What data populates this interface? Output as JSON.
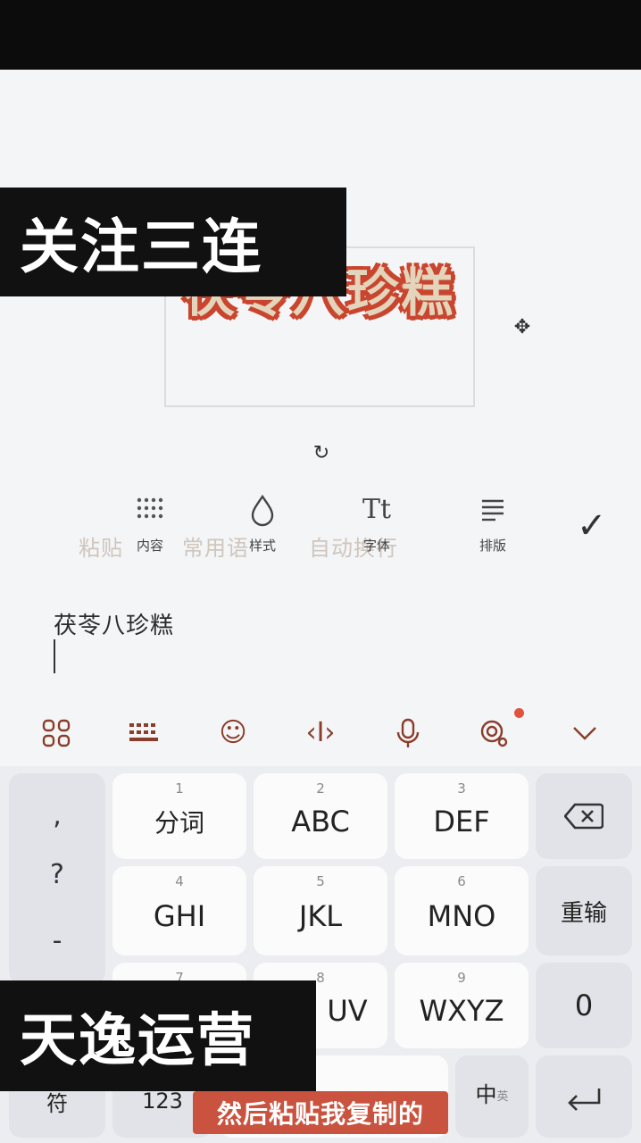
{
  "overlay": {
    "top_banner": "关注三连",
    "bottom_banner": "天逸运营",
    "caption": "然后粘贴我复制的"
  },
  "canvas": {
    "sticker_text": "茯苓八珍糕",
    "move_icon": "move-icon",
    "rotate_icon": "rotate-icon"
  },
  "toolbar": {
    "tools": [
      {
        "icon": "grid-dots-icon",
        "label": "内容"
      },
      {
        "icon": "droplet-icon",
        "label": "样式"
      },
      {
        "icon": "text-size-icon",
        "label": "字体"
      },
      {
        "icon": "align-lines-icon",
        "label": "排版"
      }
    ],
    "ghost_labels": [
      "粘贴",
      "常用语",
      "自动换行"
    ],
    "confirm_icon": "check-icon"
  },
  "input": {
    "value": "茯苓八珍糕"
  },
  "keyboard_toolbar": [
    "apps-icon",
    "keyboard-icon",
    "emoji-icon",
    "cursor-move-icon",
    "microphone-icon",
    "skin-icon",
    "chevron-down-icon"
  ],
  "keyboard": {
    "symbols": [
      ",",
      "?",
      "-"
    ],
    "keys": [
      {
        "num": "1",
        "label": "分词"
      },
      {
        "num": "2",
        "label": "ABC"
      },
      {
        "num": "3",
        "label": "DEF"
      },
      {
        "num": "4",
        "label": "GHI"
      },
      {
        "num": "5",
        "label": "JKL"
      },
      {
        "num": "6",
        "label": "MNO"
      },
      {
        "num": "7",
        "label": ""
      },
      {
        "num": "8",
        "label": "UV"
      },
      {
        "num": "9",
        "label": "WXYZ"
      }
    ],
    "right": {
      "delete_icon": "backspace-icon",
      "reinput": "重输",
      "zero": "0",
      "enter_icon": "enter-icon"
    },
    "bottom": {
      "symbol": "符",
      "numbers": "123",
      "lang_main": "中",
      "lang_sub": "英"
    }
  }
}
